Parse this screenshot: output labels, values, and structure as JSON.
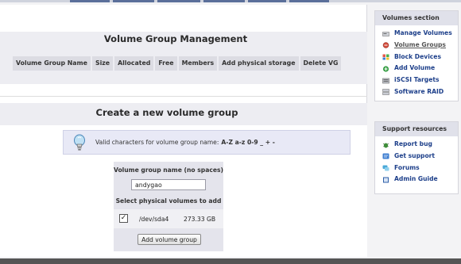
{
  "volume_group_management": {
    "title": "Volume Group Management",
    "columns": [
      "Volume Group Name",
      "Size",
      "Allocated",
      "Free",
      "Members",
      "Add physical storage",
      "Delete VG"
    ]
  },
  "create_vg": {
    "title": "Create a new volume group",
    "tip_text": "Valid characters for volume group name:",
    "tip_chars": "A-Z a-z 0-9 _ + -",
    "name_label": "Volume group name (no spaces)",
    "name_value": "andygao",
    "pv_label": "Select physical volumes to add",
    "pv_rows": [
      {
        "device": "/dev/sda4",
        "size": "273.33 GB",
        "checked": "✓"
      }
    ],
    "submit_label": "Add volume group"
  },
  "sidebar": {
    "volumes": {
      "title": "Volumes section",
      "items": [
        {
          "label": "Manage Volumes",
          "icon": "disk-icon"
        },
        {
          "label": "Volume Groups",
          "icon": "volume-group-icon"
        },
        {
          "label": "Block Devices",
          "icon": "block-device-icon"
        },
        {
          "label": "Add Volume",
          "icon": "add-icon"
        },
        {
          "label": "iSCSI Targets",
          "icon": "iscsi-icon"
        },
        {
          "label": "Software RAID",
          "icon": "raid-icon"
        }
      ]
    },
    "support": {
      "title": "Support resources",
      "items": [
        {
          "label": "Report bug",
          "icon": "bug-icon"
        },
        {
          "label": "Get support",
          "icon": "support-icon"
        },
        {
          "label": "Forums",
          "icon": "forum-icon"
        },
        {
          "label": "Admin Guide",
          "icon": "guide-icon"
        }
      ]
    }
  },
  "colors": {
    "link": "#1d3f8a",
    "panel_head": "#e0e1ea",
    "section_band": "#ededf2",
    "tip_bg": "#e8e9f6"
  }
}
